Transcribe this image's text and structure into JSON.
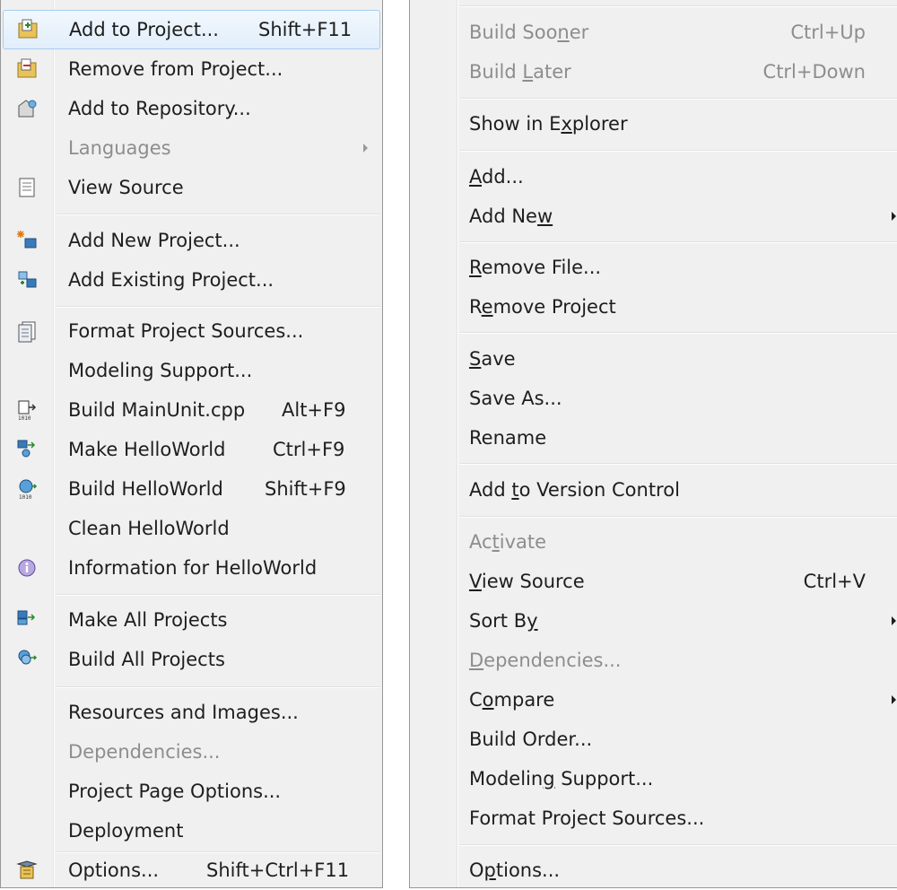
{
  "left_menu": {
    "items": [
      {
        "label": "Add to Project...",
        "shortcut": "Shift+F11",
        "icon": "add-to-project-icon"
      },
      {
        "label": "Remove from Project...",
        "icon": "remove-from-project-icon"
      },
      {
        "label": "Add to Repository...",
        "icon": "add-to-repository-icon"
      },
      {
        "label": "Languages",
        "disabled": true
      },
      {
        "label": "View Source",
        "icon": "view-source-icon"
      },
      {
        "label": "Add New Project...",
        "icon": "add-new-project-icon"
      },
      {
        "label": "Add Existing Project...",
        "icon": "add-existing-project-icon"
      },
      {
        "label": "Format Project Sources...",
        "icon": "format-sources-icon"
      },
      {
        "label": "Modeling Support..."
      },
      {
        "label": "Build MainUnit.cpp",
        "shortcut": "Alt+F9",
        "icon": "build-file-icon"
      },
      {
        "label": "Make HelloWorld",
        "shortcut": "Ctrl+F9",
        "icon": "make-project-icon"
      },
      {
        "label": "Build HelloWorld",
        "shortcut": "Shift+F9",
        "icon": "build-project-icon"
      },
      {
        "label": "Clean HelloWorld"
      },
      {
        "label": "Information for HelloWorld",
        "icon": "information-icon"
      },
      {
        "label": "Make All Projects",
        "icon": "make-all-icon"
      },
      {
        "label": "Build All Projects",
        "icon": "build-all-icon"
      },
      {
        "label": "Resources and Images..."
      },
      {
        "label": "Dependencies...",
        "disabled": true
      },
      {
        "label": "Project Page Options..."
      },
      {
        "label": "Deployment"
      },
      {
        "label": "Options...",
        "shortcut": "Shift+Ctrl+F11",
        "icon": "options-icon"
      }
    ]
  },
  "right_menu": {
    "items": [
      {
        "pre": "Build Soo",
        "acc": "n",
        "post": "er",
        "shortcut": "Ctrl+Up",
        "disabled": true
      },
      {
        "pre": "Build ",
        "acc": "L",
        "post": "ater",
        "shortcut": "Ctrl+Down",
        "disabled": true
      },
      {
        "pre": "Show in E",
        "acc": "x",
        "post": "plorer"
      },
      {
        "pre": "",
        "acc": "A",
        "post": "dd..."
      },
      {
        "pre": "Add Ne",
        "acc": "w",
        "post": ""
      },
      {
        "pre": "",
        "acc": "R",
        "post": "emove File..."
      },
      {
        "pre": "R",
        "acc": "e",
        "post": "move Project"
      },
      {
        "pre": "",
        "acc": "S",
        "post": "ave"
      },
      {
        "pre": "Save As...",
        "acc": "",
        "post": ""
      },
      {
        "pre": "Rename",
        "acc": "",
        "post": ""
      },
      {
        "pre": "Add ",
        "acc": "t",
        "post": "o Version Control"
      },
      {
        "pre": "Ac",
        "acc": "t",
        "post": "ivate",
        "disabled": true
      },
      {
        "pre": "",
        "acc": "V",
        "post": "iew Source",
        "shortcut": "Ctrl+V"
      },
      {
        "pre": "Sort B",
        "acc": "y",
        "post": ""
      },
      {
        "pre": "",
        "acc": "D",
        "post": "ependencies...",
        "disabled": true
      },
      {
        "pre": "C",
        "acc": "o",
        "post": "mpare"
      },
      {
        "pre": "Build Order...",
        "acc": "",
        "post": ""
      },
      {
        "pre": "Modelin",
        "acc": "g",
        "post": " Support..."
      },
      {
        "pre": "Format Project Sources...",
        "acc": "",
        "post": ""
      },
      {
        "pre": "O",
        "acc": "p",
        "post": "tions..."
      }
    ]
  }
}
